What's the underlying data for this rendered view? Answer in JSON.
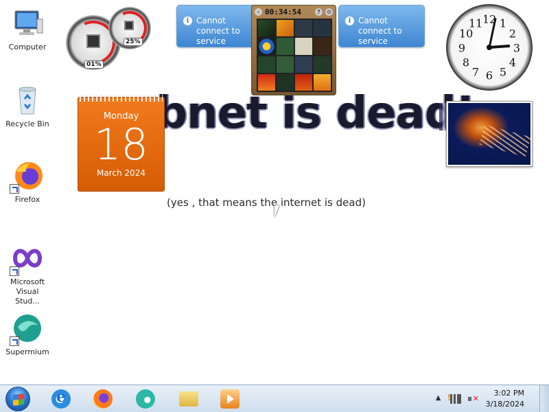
{
  "wallpaper": {
    "title": "abnet is dead!",
    "subtitle": "(yes , that means the internet is dead)"
  },
  "desktop_icons": [
    {
      "label": "Computer",
      "icon": "computer-icon",
      "shortcut": false
    },
    {
      "label": "Recycle Bin",
      "icon": "recycle-bin-icon",
      "shortcut": false
    },
    {
      "label": "Firefox",
      "icon": "firefox-icon",
      "shortcut": true
    },
    {
      "label": "Microsoft Visual Stud...",
      "icon": "visual-studio-icon",
      "shortcut": true
    },
    {
      "label": "Supermium",
      "icon": "supermium-icon",
      "shortcut": true
    }
  ],
  "gadgets": {
    "meter": {
      "cpu_label": "01%",
      "memory_label": "25%"
    },
    "feed_left": {
      "message": "Cannot connect to service"
    },
    "feed_right": {
      "message": "Cannot connect to service"
    },
    "puzzle": {
      "timer": "00:34:54"
    },
    "calendar": {
      "weekday": "Monday",
      "day": "18",
      "month_year": "March 2024"
    },
    "clock": {
      "numbers": [
        "12",
        "1",
        "2",
        "3",
        "4",
        "5",
        "6",
        "7",
        "8",
        "9",
        "10",
        "11"
      ]
    }
  },
  "taskbar": {
    "pinned": [
      {
        "name": "internet-explorer",
        "icon": "internet-explorer-icon"
      },
      {
        "name": "firefox",
        "icon": "firefox-icon"
      },
      {
        "name": "supermium",
        "icon": "supermium-icon"
      },
      {
        "name": "file-explorer",
        "icon": "folder-icon"
      },
      {
        "name": "media-player",
        "icon": "media-player-icon"
      }
    ],
    "tray": {
      "time": "3:02 PM",
      "date": "3/18/2024"
    }
  },
  "colors": {
    "calendar": "#e8690e",
    "feed": "#4a90d9",
    "taskbar": "#dce7f3"
  }
}
